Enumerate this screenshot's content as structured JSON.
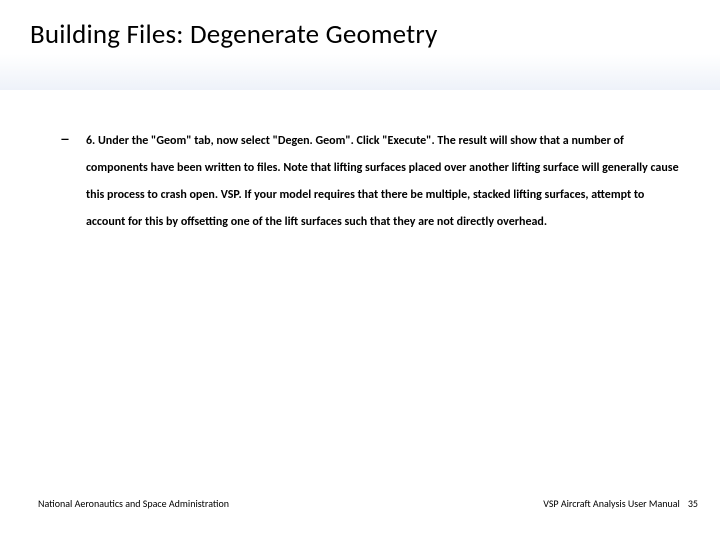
{
  "slide": {
    "title": "Building Files: Degenerate Geometry",
    "bullet": {
      "dash": "–",
      "text": "6. Under the \"Geom\" tab, now select \"Degen. Geom\". Click \"Execute\". The result will show that a number of components have been written to files. Note that lifting surfaces placed over another lifting surface will generally cause this process to crash open. VSP. If your model requires that there be multiple, stacked lifting surfaces, attempt to account for this by offsetting one of the lift surfaces such that they are not directly overhead."
    }
  },
  "footer": {
    "org": "National Aeronautics and Space Administration",
    "manual": "VSP Aircraft Analysis User Manual",
    "page": "35"
  }
}
